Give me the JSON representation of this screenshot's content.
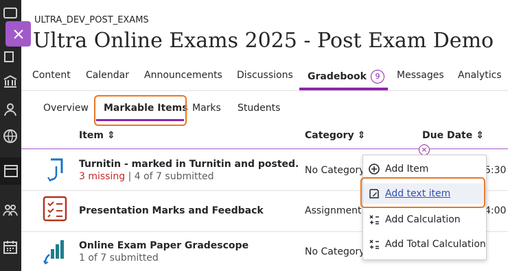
{
  "course": {
    "code": "ULTRA_DEV_POST_EXAMS",
    "title": "Ultra Online Exams 2025 - Post Exam Demo"
  },
  "nav_tabs": [
    {
      "label": "Content"
    },
    {
      "label": "Calendar"
    },
    {
      "label": "Announcements"
    },
    {
      "label": "Discussions"
    },
    {
      "label": "Gradebook",
      "badge": "9",
      "active": true
    },
    {
      "label": "Messages"
    },
    {
      "label": "Analytics"
    }
  ],
  "sub_tabs": [
    {
      "label": "Overview"
    },
    {
      "label": "Markable Items",
      "active": true
    },
    {
      "label": "Marks"
    },
    {
      "label": "Students"
    }
  ],
  "columns": {
    "item": "Item",
    "category": "Category",
    "due_date": "Due Date"
  },
  "items": [
    {
      "title": "Turnitin - marked in Turnitin and posted.",
      "missing": "3 missing",
      "separator": " | ",
      "submitted": "4 of 7 submitted",
      "category": "No Category",
      "due": "5:30",
      "icon": "turnitin-icon"
    },
    {
      "title": "Presentation Marks and Feedback",
      "category": "Assignment",
      "due": "4:00",
      "icon": "assignment-list-icon"
    },
    {
      "title": "Online Exam Paper Gradescope",
      "submitted": "1 of 7 submitted",
      "category": "No Category",
      "icon": "gradescope-icon"
    }
  ],
  "add_menu": [
    {
      "label": "Add Item",
      "icon": "plus-circle-icon"
    },
    {
      "label": "Add text item",
      "icon": "text-item-icon",
      "highlighted": true
    },
    {
      "label": "Add Calculation",
      "icon": "calculation-icon"
    },
    {
      "label": "Add Total Calculation",
      "icon": "total-calculation-icon"
    }
  ],
  "colors": {
    "accent": "#8e24aa",
    "highlight": "#e87722",
    "link": "#2f52ab",
    "missing": "#c62828",
    "rail": "#262626"
  }
}
